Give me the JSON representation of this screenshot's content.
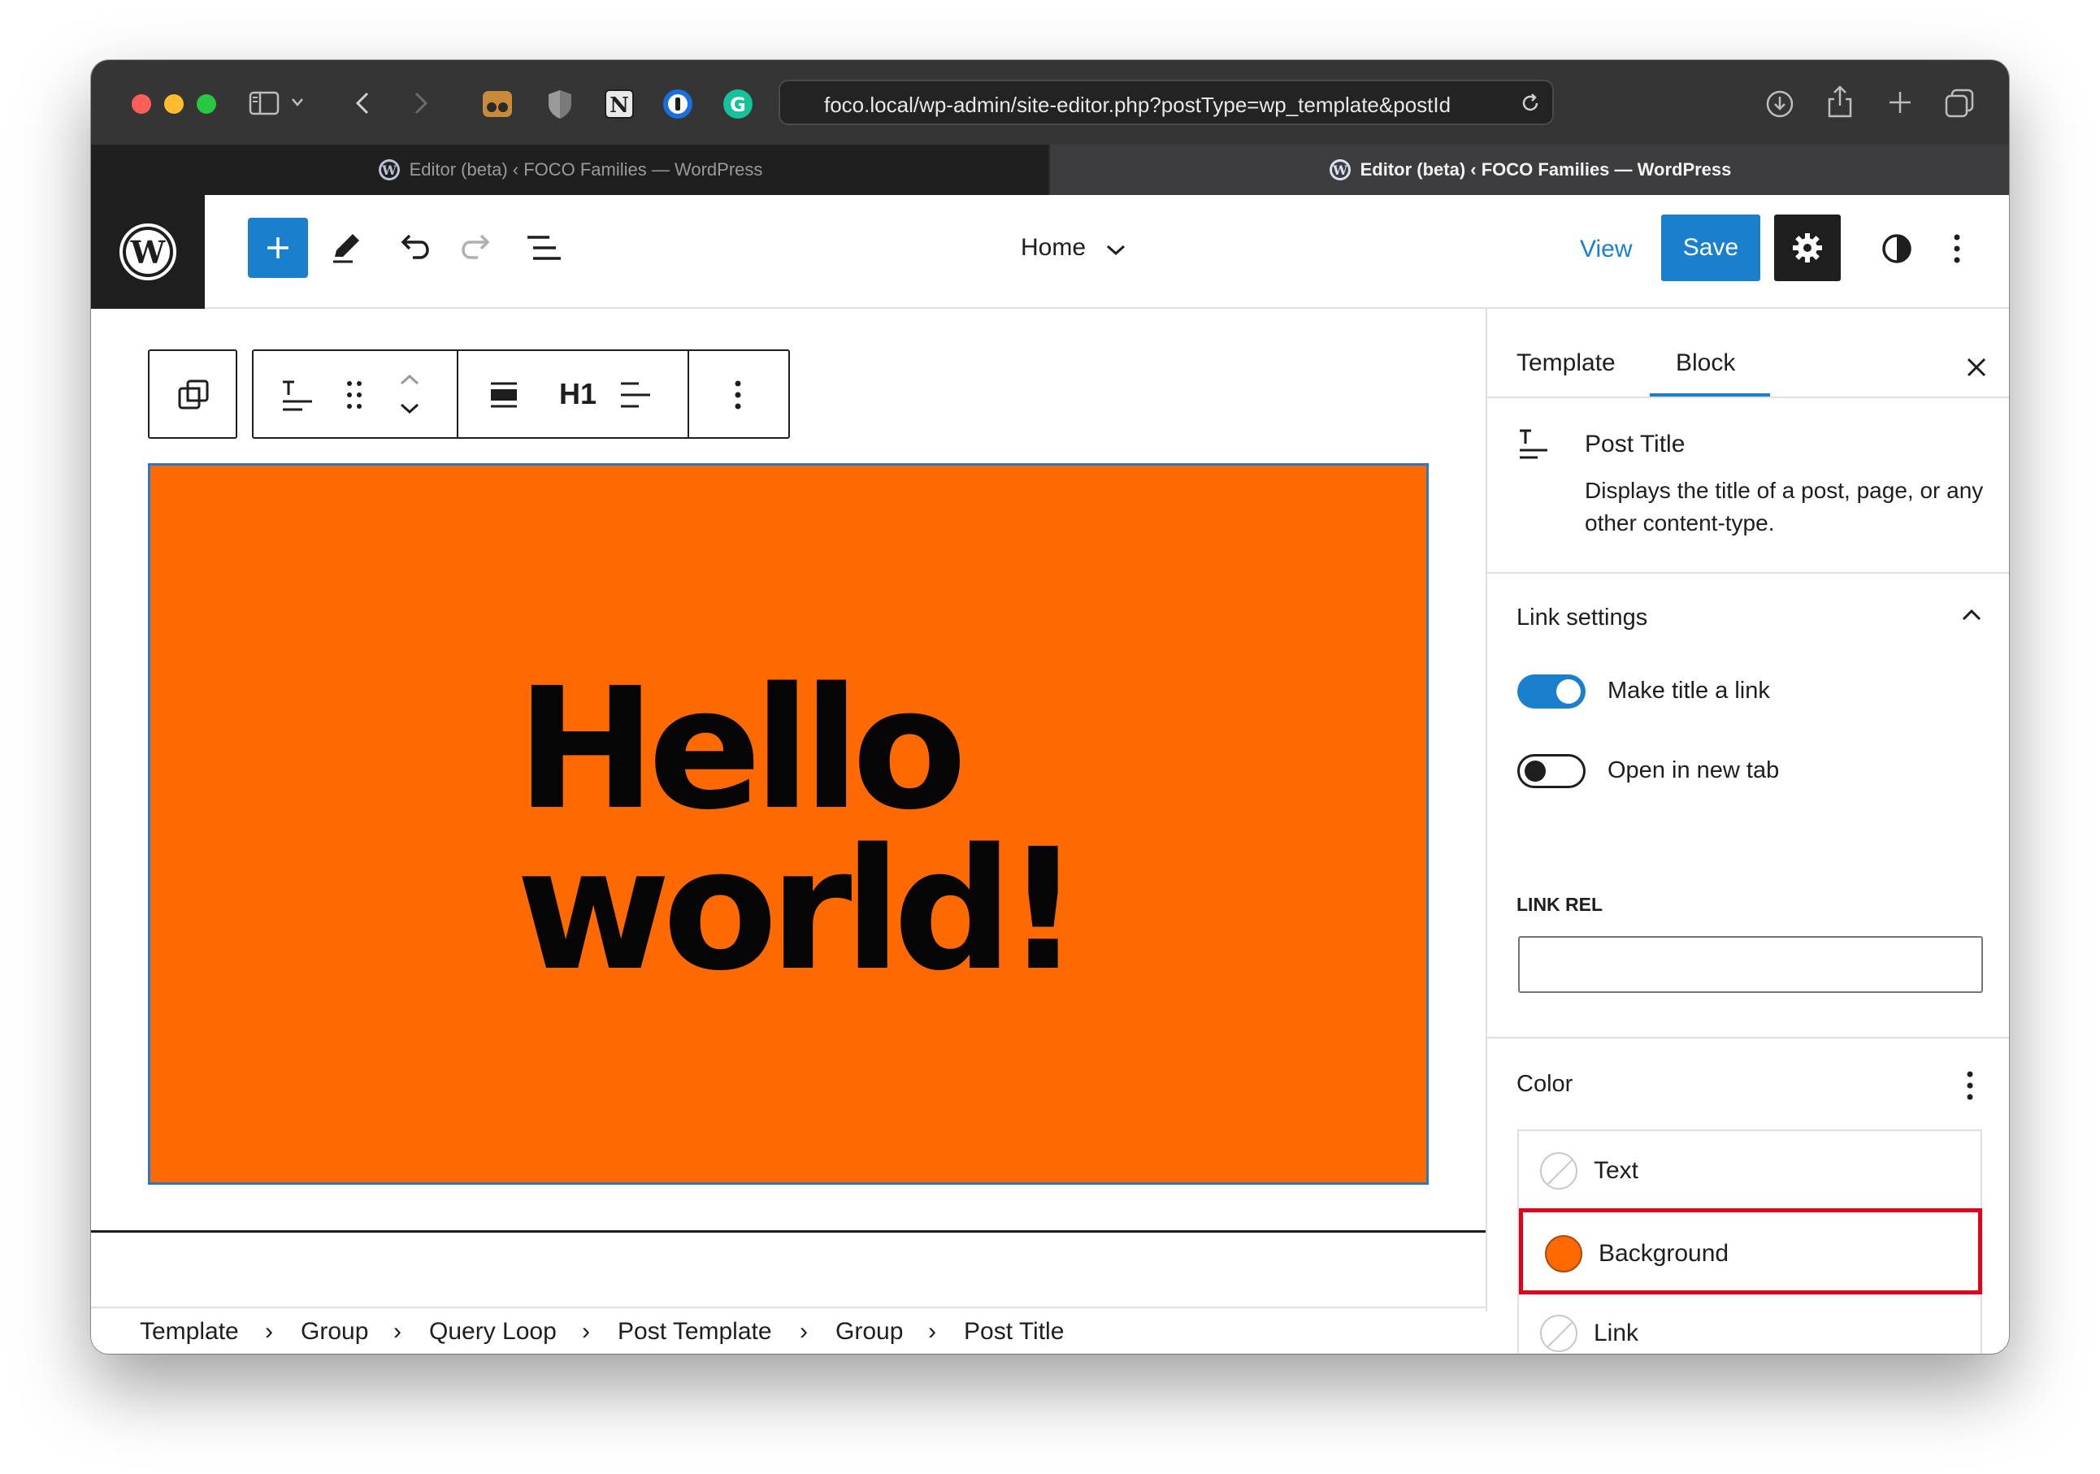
{
  "browser": {
    "url": "foco.local/wp-admin/site-editor.php?postType=wp_template&postId",
    "tabs": [
      {
        "title": "Editor (beta) ‹ FOCO Families — WordPress",
        "active": false
      },
      {
        "title": "Editor (beta) ‹ FOCO Families — WordPress",
        "active": true
      }
    ],
    "colors": {
      "chrome": "#353536",
      "tab_inactive": "#2a2a2a",
      "tab_active": "#3d3d3f"
    }
  },
  "header": {
    "template_selector": "Home",
    "view_label": "View",
    "save_label": "Save",
    "icons": [
      "wordpress-logo-icon",
      "plus-icon",
      "pencil-icon",
      "undo-icon",
      "redo-icon",
      "list-view-icon",
      "chevron-down-icon",
      "gear-icon",
      "contrast-icon",
      "kebab-icon"
    ]
  },
  "block_toolbar": {
    "heading_level": "H1",
    "icons": [
      "transform-icon",
      "post-title-icon",
      "drag-handle-icon",
      "move-up-icon",
      "move-down-icon",
      "align-icon",
      "text-align-icon",
      "kebab-icon"
    ]
  },
  "canvas": {
    "title_line1": "Hello",
    "title_line2": "world!",
    "background_color": "#ff6a00"
  },
  "sidebar": {
    "tabs": [
      {
        "label": "Template",
        "active": false
      },
      {
        "label": "Block",
        "active": true
      }
    ],
    "block": {
      "name": "Post Title",
      "description": "Displays the title of a post, page, or any other content-type."
    },
    "link_settings": {
      "title": "Link settings",
      "make_title_link": {
        "label": "Make title a link",
        "checked": true
      },
      "open_new_tab": {
        "label": "Open in new tab",
        "checked": false
      },
      "link_rel_label": "LINK REL",
      "link_rel_value": ""
    },
    "color": {
      "title": "Color",
      "items": [
        {
          "label": "Text",
          "swatch": "none"
        },
        {
          "label": "Background",
          "swatch": "#ff6a00",
          "highlighted": true
        },
        {
          "label": "Link",
          "swatch": "none"
        }
      ]
    }
  },
  "breadcrumb": [
    "Template",
    "Group",
    "Query Loop",
    "Post Template",
    "Group",
    "Post Title"
  ],
  "accent_color": "#1a7fcc",
  "highlight_color": "#e4001b"
}
